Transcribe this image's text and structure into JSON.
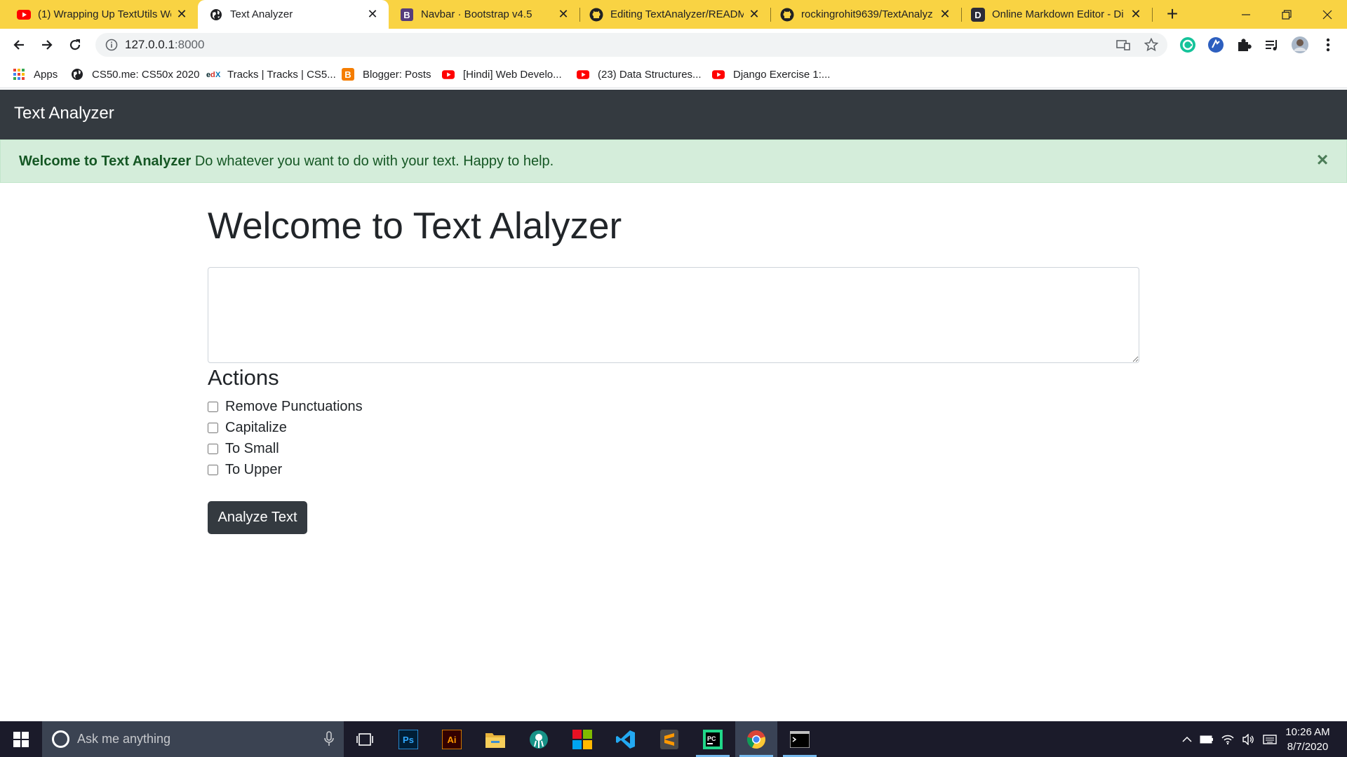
{
  "browser": {
    "tabs": [
      {
        "title": "(1) Wrapping Up TextUtils We",
        "favicon": "youtube-icon",
        "active": false
      },
      {
        "title": "Text Analyzer",
        "favicon": "globe-icon",
        "active": true
      },
      {
        "title": "Navbar · Bootstrap v4.5",
        "favicon": "bootstrap-icon",
        "active": false
      },
      {
        "title": "Editing TextAnalyzer/READM",
        "favicon": "github-icon",
        "active": false
      },
      {
        "title": "rockingrohit9639/TextAnalyz",
        "favicon": "github-icon",
        "active": false
      },
      {
        "title": "Online Markdown Editor - Di",
        "favicon": "dillinger-icon",
        "active": false
      }
    ],
    "close_glyph": "✕",
    "new_tab_glyph": "+",
    "address": {
      "host": "127.0.0.1",
      "port": ":8000"
    },
    "bookmarks": [
      {
        "label": "Apps",
        "icon": "apps-grid-icon"
      },
      {
        "label": "CS50.me: CS50x 2020",
        "icon": "globe-icon"
      },
      {
        "label": "Tracks | Tracks | CS5...",
        "icon": "edx-icon"
      },
      {
        "label": "Blogger: Posts",
        "icon": "blogger-icon"
      },
      {
        "label": "[Hindi] Web Develo...",
        "icon": "youtube-icon"
      },
      {
        "label": "(23) Data Structures...",
        "icon": "youtube-icon"
      },
      {
        "label": "Django Exercise 1:...",
        "icon": "youtube-icon"
      }
    ],
    "colors": {
      "tabstrip": "#f9d343",
      "navbar": "#343a40",
      "alert_bg": "#d4edda",
      "alert_text": "#155724"
    }
  },
  "page": {
    "brand": "Text Analyzer",
    "alert": {
      "strong": "Welcome to Text Analyzer",
      "text": " Do whatever you want to do with your text. Happy to help.",
      "close": "×"
    },
    "heading": "Welcome to Text Alalyzer",
    "textarea_value": "",
    "actions_heading": "Actions",
    "actions": [
      {
        "label": "Remove Punctuations",
        "checked": false
      },
      {
        "label": "Capitalize",
        "checked": false
      },
      {
        "label": "To Small",
        "checked": false
      },
      {
        "label": "To Upper",
        "checked": false
      }
    ],
    "submit_label": "Analyze Text"
  },
  "taskbar": {
    "search_placeholder": "Ask me anything",
    "apps": [
      "task-view-icon",
      "photoshop-icon",
      "illustrator-icon",
      "file-explorer-icon",
      "gitkraken-icon",
      "app-icon",
      "vscode-icon",
      "sublime-text-icon",
      "pycharm-icon",
      "chrome-icon",
      "terminal-icon"
    ],
    "photoshop_label": "Ps",
    "illustrator_label": "Ai",
    "pycharm_label": "PC",
    "time": "10:26 AM",
    "date": "8/7/2020"
  }
}
